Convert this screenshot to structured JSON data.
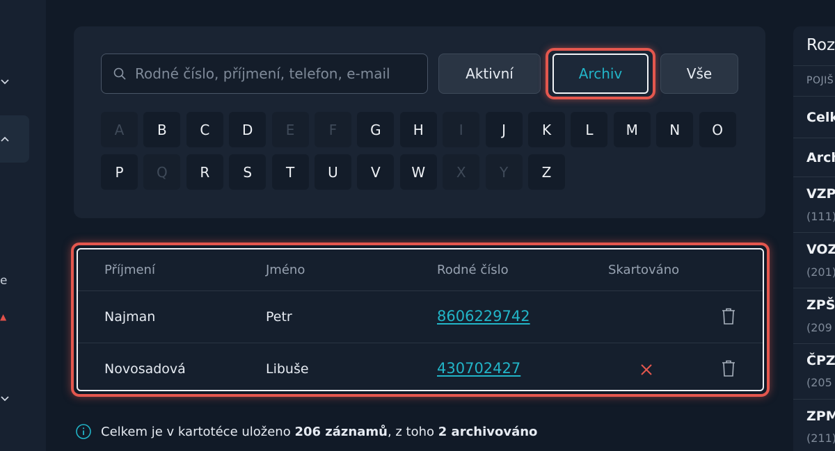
{
  "sidebar": {
    "partial_letter": "e"
  },
  "search": {
    "placeholder": "Rodné číslo, příjmení, telefon, e-mail",
    "value": ""
  },
  "filter_tabs": {
    "active_label": "Aktivní",
    "archive_label": "Archiv",
    "all_label": "Vše",
    "selected": "Archiv"
  },
  "alphabet": {
    "row1": [
      {
        "letter": "A",
        "enabled": false
      },
      {
        "letter": "B",
        "enabled": true
      },
      {
        "letter": "C",
        "enabled": true
      },
      {
        "letter": "D",
        "enabled": true
      },
      {
        "letter": "E",
        "enabled": false
      },
      {
        "letter": "F",
        "enabled": false
      },
      {
        "letter": "G",
        "enabled": true
      },
      {
        "letter": "H",
        "enabled": true
      },
      {
        "letter": "I",
        "enabled": false
      },
      {
        "letter": "J",
        "enabled": true
      },
      {
        "letter": "K",
        "enabled": true
      },
      {
        "letter": "L",
        "enabled": true
      },
      {
        "letter": "M",
        "enabled": true
      },
      {
        "letter": "N",
        "enabled": true
      },
      {
        "letter": "O",
        "enabled": true
      }
    ],
    "row2": [
      {
        "letter": "P",
        "enabled": true
      },
      {
        "letter": "Q",
        "enabled": false
      },
      {
        "letter": "R",
        "enabled": true
      },
      {
        "letter": "S",
        "enabled": true
      },
      {
        "letter": "T",
        "enabled": true
      },
      {
        "letter": "U",
        "enabled": true
      },
      {
        "letter": "V",
        "enabled": true
      },
      {
        "letter": "W",
        "enabled": true
      },
      {
        "letter": "X",
        "enabled": false
      },
      {
        "letter": "Y",
        "enabled": false
      },
      {
        "letter": "Z",
        "enabled": true
      }
    ]
  },
  "table": {
    "headers": [
      "Příjmení",
      "Jméno",
      "Rodné číslo",
      "Skartováno"
    ],
    "rows": [
      {
        "surname": "Najman",
        "name": "Petr",
        "birth_number": "8606229742",
        "shredded": false
      },
      {
        "surname": "Novosadová",
        "name": "Libuše",
        "birth_number": "430702427",
        "shredded": true
      }
    ]
  },
  "summary": {
    "prefix": "Celkem je v kartotéce uloženo ",
    "total": "206 záznamů",
    "middle": ", z toho ",
    "archived": "2 archivováno"
  },
  "right_panel": {
    "title": "Roz",
    "subtitle": "POJIŠ",
    "items": [
      {
        "label": "Celk",
        "count": ""
      },
      {
        "label": "Arch",
        "count": ""
      },
      {
        "label": "VZP",
        "count": "(111)"
      },
      {
        "label": "VOZ",
        "count": "(201)"
      },
      {
        "label": "ZPŠ",
        "count": "(209"
      },
      {
        "label": "ČPZ",
        "count": "(205"
      },
      {
        "label": "ZPM",
        "count": "(211)"
      }
    ]
  },
  "colors": {
    "accent": "#22b5c8",
    "highlight": "#e4574e",
    "background": "#111a27"
  }
}
